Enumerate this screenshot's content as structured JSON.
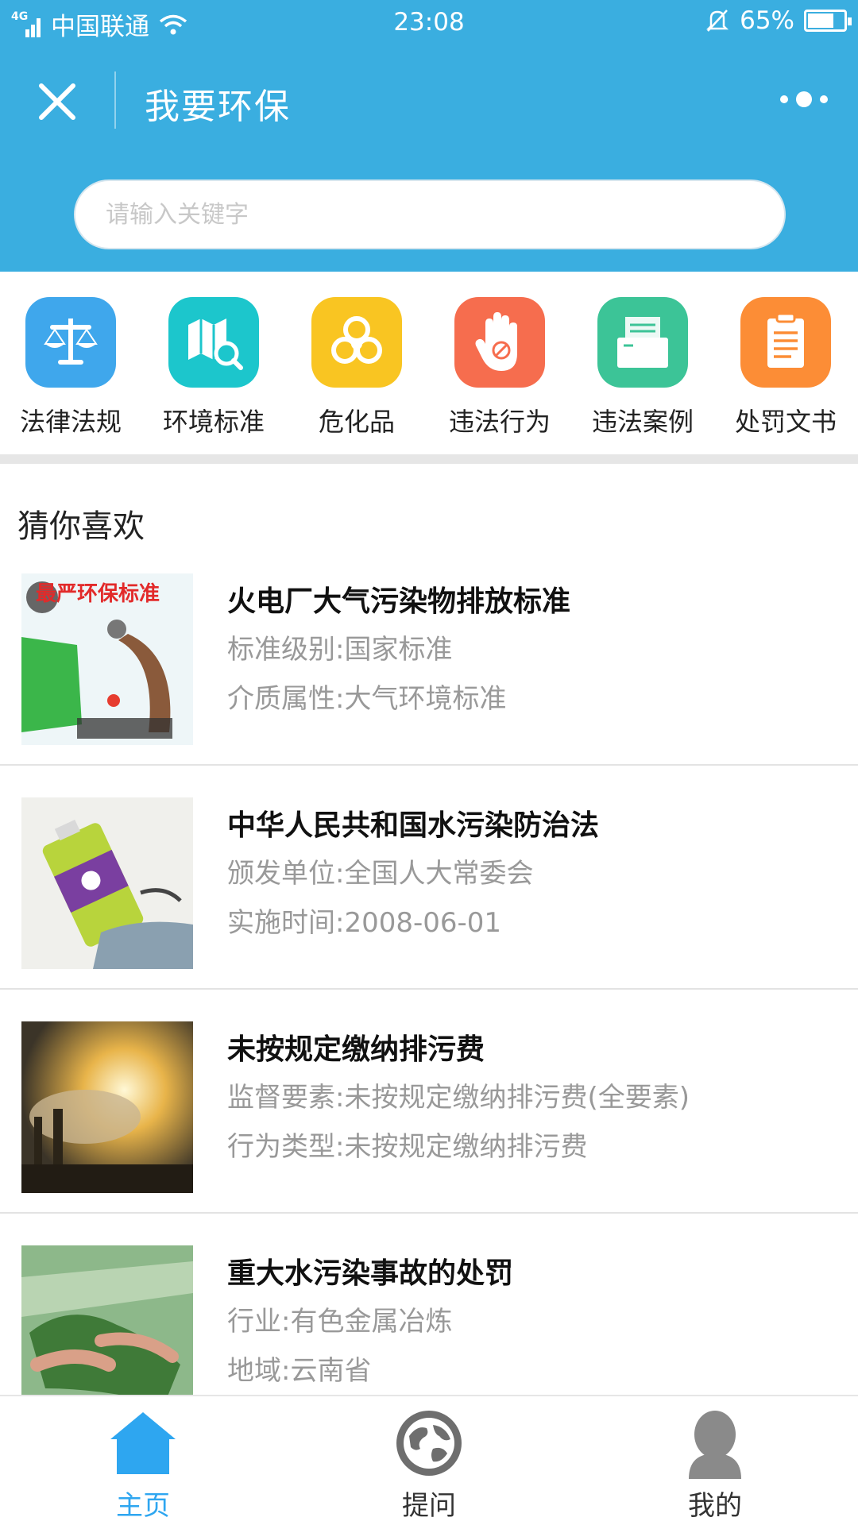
{
  "status_bar": {
    "network": "4G",
    "carrier": "中国联通",
    "time": "23:08",
    "battery": "65%"
  },
  "navbar": {
    "title": "我要环保"
  },
  "search": {
    "placeholder": "请输入关键字"
  },
  "categories": [
    {
      "label": "法律法规",
      "icon": "scale-icon",
      "color": "#3fa7ec"
    },
    {
      "label": "环境标准",
      "icon": "map-search-icon",
      "color": "#1cc6cc"
    },
    {
      "label": "危化品",
      "icon": "biohazard-icon",
      "color": "#f9c522"
    },
    {
      "label": "违法行为",
      "icon": "stop-hand-icon",
      "color": "#f66d4e"
    },
    {
      "label": "违法案例",
      "icon": "folder-icon",
      "color": "#3cc497"
    },
    {
      "label": "处罚文书",
      "icon": "document-icon",
      "color": "#fc8d36"
    }
  ],
  "recommend": {
    "title": "猜你喜欢",
    "items": [
      {
        "title": "火电厂大气污染物排放标准",
        "line1": "标准级别:国家标准",
        "line2": "介质属性:大气环境标准",
        "thumb_caption": "最严环保标准"
      },
      {
        "title": "中华人民共和国水污染防治法",
        "line1": "颁发单位:全国人大常委会",
        "line2": "实施时间:2008-06-01"
      },
      {
        "title": "未按规定缴纳排污费",
        "line1": "监督要素:未按规定缴纳排污费(全要素)",
        "line2": "行为类型:未按规定缴纳排污费"
      },
      {
        "title": "重大水污染事故的处罚",
        "line1": "行业:有色金属冶炼",
        "line2": "地域:云南省"
      }
    ]
  },
  "tabs": [
    {
      "label": "主页",
      "icon": "home-icon",
      "active": true
    },
    {
      "label": "提问",
      "icon": "globe-icon",
      "active": false
    },
    {
      "label": "我的",
      "icon": "user-icon",
      "active": false
    }
  ],
  "colors": {
    "header": "#3aaee0",
    "accent": "#2ea6f0"
  }
}
